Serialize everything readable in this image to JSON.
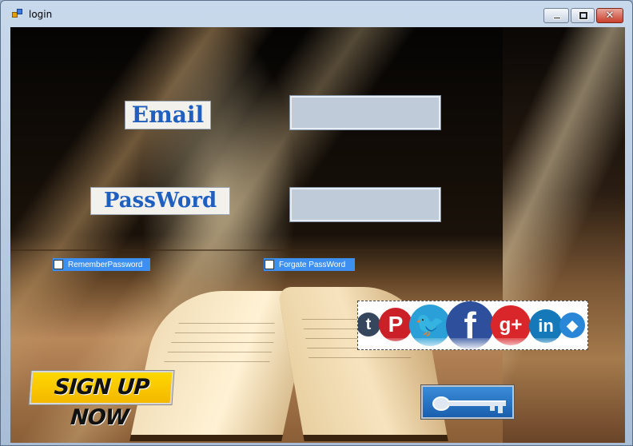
{
  "window": {
    "title": "login",
    "controls": {
      "minimize": "minimize",
      "maximize": "maximize",
      "close": "✕"
    }
  },
  "form": {
    "email_label": "Email",
    "password_label": "PassWord",
    "email_value": "",
    "password_value": "",
    "remember_label": "RememberPassword",
    "forgot_label": "Forgate PassWord",
    "remember_checked": false,
    "forgot_checked": false
  },
  "social": {
    "icons": [
      "tumblr-icon",
      "pinterest-icon",
      "twitter-icon",
      "facebook-icon",
      "google-plus-icon",
      "linkedin-icon",
      "dropbox-icon"
    ]
  },
  "buttons": {
    "signup_label": "SIGN UP NOW",
    "login_icon": "key-icon"
  },
  "colors": {
    "label_text": "#1f5fbf",
    "checkbox_strip": "#3d8ff0",
    "signup_bg": "#ffd800"
  }
}
